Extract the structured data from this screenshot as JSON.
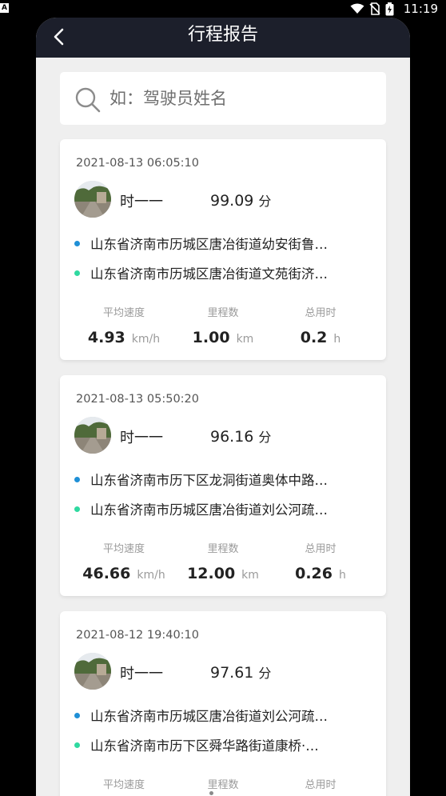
{
  "status_bar": {
    "notification_icon": "A",
    "time": "11:19",
    "icons": [
      "wifi-icon",
      "no-sim-icon",
      "battery-icon"
    ]
  },
  "header": {
    "title": "行程报告"
  },
  "search": {
    "placeholder": "如：驾驶员姓名",
    "value": ""
  },
  "stat_labels": {
    "speed": "平均速度",
    "distance": "里程数",
    "duration": "总用时"
  },
  "units": {
    "speed": "km/h",
    "distance": "km",
    "duration": "h",
    "score": "分"
  },
  "trips": [
    {
      "datetime": "2021-08-13 06:05:10",
      "driver": "时一一",
      "score": "99.09",
      "start": "山东省济南市历城区唐冶街道幼安街鲁…",
      "end": "山东省济南市历城区唐冶街道文苑街济…",
      "speed": "4.93",
      "distance": "1.00",
      "duration": "0.2"
    },
    {
      "datetime": "2021-08-13 05:50:20",
      "driver": "时一一",
      "score": "96.16",
      "start": "山东省济南市历下区龙洞街道奥体中路…",
      "end": "山东省济南市历城区唐冶街道刘公河疏…",
      "speed": "46.66",
      "distance": "12.00",
      "duration": "0.26"
    },
    {
      "datetime": "2021-08-12 19:40:10",
      "driver": "时一一",
      "score": "97.61",
      "start": "山东省济南市历城区唐冶街道刘公河疏…",
      "end": "山东省济南市历下区舜华路街道康桥·…",
      "speed": "",
      "distance": "",
      "duration": ""
    }
  ],
  "colors": {
    "nav_bg": "#1c1f2b",
    "page_bg": "#efefef",
    "start_dot": "#1f8fd6",
    "end_dot": "#2fd9a0"
  }
}
